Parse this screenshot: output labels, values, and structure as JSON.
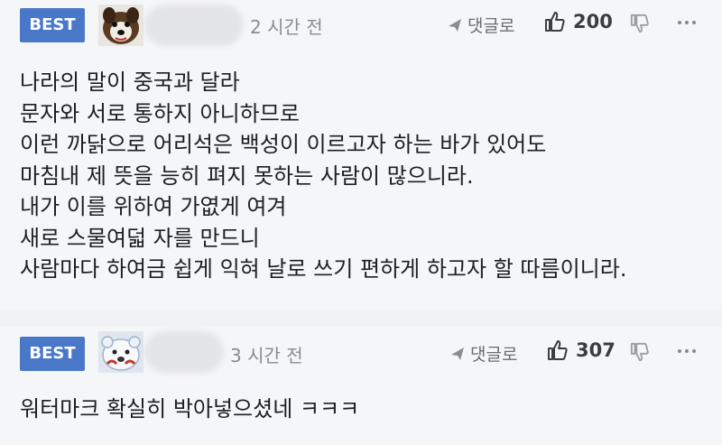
{
  "comments": [
    {
      "badge": "BEST",
      "time": "2 시간 전",
      "reply_label": "댓글로",
      "likes": "200",
      "lines": [
        "나라의 말이 중국과 달라",
        "문자와 서로 통하지 아니하므로",
        "이런 까닭으로 어리석은 백성이 이르고자 하는 바가 있어도",
        "마침내 제 뜻을 능히 펴지 못하는 사람이 많으니라.",
        "내가 이를 위하여 가엾게 여겨",
        "새로 스물여덟 자를 만드니",
        "사람마다 하여금 쉽게 익혀 날로 쓰기 편하게 하고자 할 따름이니라."
      ]
    },
    {
      "badge": "BEST",
      "time": "3 시간 전",
      "reply_label": "댓글로",
      "likes": "307",
      "lines": [
        "워터마크 확실히 박아넣으셨네 ㅋㅋㅋ"
      ]
    }
  ],
  "icons": {
    "reply": "reply-arrow-icon",
    "like": "thumbs-up-icon",
    "dislike": "thumbs-down-icon",
    "more": "more-dots-icon"
  },
  "colors": {
    "badge": "#4a78c8"
  }
}
